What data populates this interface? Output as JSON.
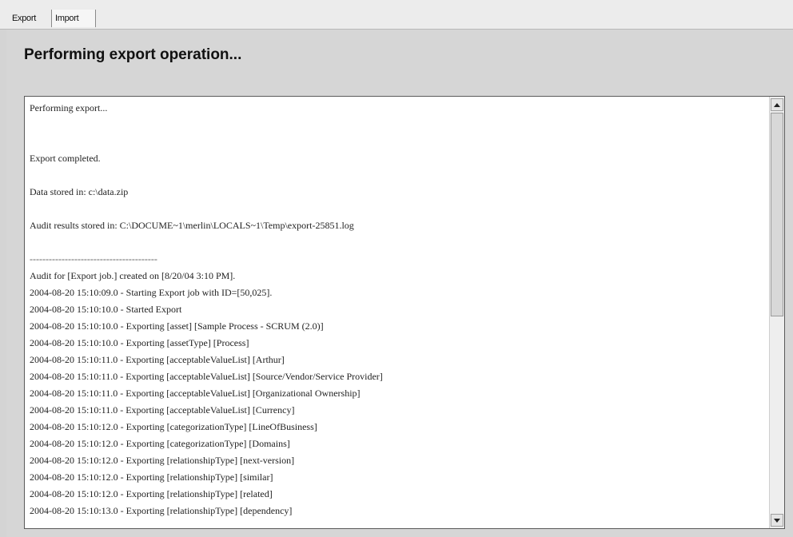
{
  "tabs": [
    {
      "label": "Export"
    },
    {
      "label": "Import"
    }
  ],
  "page": {
    "title": "Performing export operation..."
  },
  "log": {
    "lines": [
      "Performing export...",
      "",
      "",
      "Export completed.",
      "",
      "Data stored in: c:\\data.zip",
      "",
      "Audit results stored in: C:\\DOCUME~1\\merlin\\LOCALS~1\\Temp\\export-25851.log",
      "",
      "----------------------------------------",
      "Audit for [Export job.] created on [8/20/04 3:10 PM].",
      "2004-08-20 15:10:09.0 - Starting Export job with ID=[50,025].",
      "2004-08-20 15:10:10.0 - Started Export",
      "2004-08-20 15:10:10.0 - Exporting [asset] [Sample Process - SCRUM (2.0)]",
      "2004-08-20 15:10:10.0 - Exporting [assetType] [Process]",
      "2004-08-20 15:10:11.0 - Exporting [acceptableValueList] [Arthur]",
      "2004-08-20 15:10:11.0 - Exporting [acceptableValueList] [Source/Vendor/Service Provider]",
      "2004-08-20 15:10:11.0 - Exporting [acceptableValueList] [Organizational Ownership]",
      "2004-08-20 15:10:11.0 - Exporting [acceptableValueList] [Currency]",
      "2004-08-20 15:10:12.0 - Exporting [categorizationType] [LineOfBusiness]",
      "2004-08-20 15:10:12.0 - Exporting [categorizationType] [Domains]",
      "2004-08-20 15:10:12.0 - Exporting [relationshipType] [next-version]",
      "2004-08-20 15:10:12.0 - Exporting [relationshipType] [similar]",
      "2004-08-20 15:10:12.0 - Exporting [relationshipType] [related]",
      "2004-08-20 15:10:13.0 - Exporting [relationshipType] [dependency]"
    ]
  },
  "icons": {
    "scroll_up": "chevron-up-icon",
    "scroll_down": "chevron-down-icon"
  },
  "colors": {
    "background": "#d4d4d4",
    "log_background": "#ffffff",
    "text": "#222222"
  }
}
